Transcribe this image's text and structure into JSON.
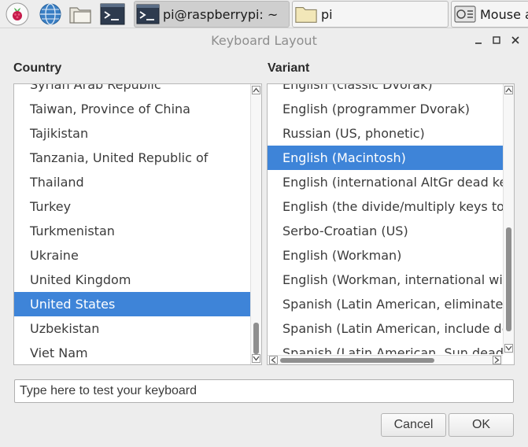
{
  "taskbar": {
    "icons": [
      "raspberry-menu-icon",
      "web-browser-icon",
      "file-manager-icon",
      "terminal-icon"
    ],
    "tasks": [
      {
        "label": "pi@raspberrypi: ~",
        "icon": "terminal-icon",
        "active": true
      },
      {
        "label": "pi",
        "icon": "folder-icon",
        "active": false
      },
      {
        "label": "Mouse a",
        "icon": "preferences-icon",
        "active": false
      }
    ]
  },
  "window": {
    "title": "Keyboard Layout",
    "controls": [
      "minimize-icon",
      "maximize-icon",
      "close-icon"
    ]
  },
  "country": {
    "label": "Country",
    "items": [
      "Syrian Arab Republic",
      "Taiwan, Province of China",
      "Tajikistan",
      "Tanzania, United Republic of",
      "Thailand",
      "Turkey",
      "Turkmenistan",
      "Ukraine",
      "United Kingdom",
      "United States",
      "Uzbekistan",
      "Viet Nam"
    ],
    "selected": "United States"
  },
  "variant": {
    "label": "Variant",
    "items": [
      "English (classic Dvorak)",
      "English (programmer Dvorak)",
      "Russian (US, phonetic)",
      "English (Macintosh)",
      "English (international AltGr dead keys)",
      "English (the divide/multiply keys toggle the layout)",
      "Serbo-Croatian (US)",
      "English (Workman)",
      "English (Workman, international with dead keys)",
      "Spanish (Latin American, eliminate dead keys)",
      "Spanish (Latin American, include dead tilde)",
      "Spanish (Latin American, Sun dead keys)"
    ],
    "selected": "English (Macintosh)"
  },
  "test_field": {
    "placeholder": "Type here to test your keyboard",
    "value": ""
  },
  "buttons": {
    "cancel": "Cancel",
    "ok": "OK"
  },
  "colors": {
    "selection": "#3e84d8",
    "window_bg": "#ededed",
    "text": "#3b3b3b"
  }
}
